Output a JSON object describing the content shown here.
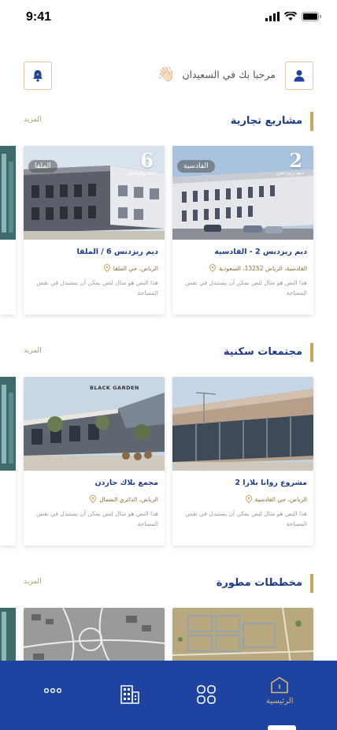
{
  "status": {
    "time": "9:41"
  },
  "header": {
    "greeting": "مرحبا بك في السعيدان",
    "wave_emoji": "👋🏻"
  },
  "sections": [
    {
      "title": "مشاريع تجارية",
      "more": "المزيد",
      "cards": [
        {
          "title": "ديم ريزدنس 2 - القادسية",
          "location": "القادسية، الرياض 13252، السعودية",
          "tag": "القادسية",
          "description": "هذا النص هو مثال لنص يمكن أن يستبدل في نفس المساحة",
          "image_text": "2",
          "image_brand": "ديم ريزدنس"
        },
        {
          "title": "ديم ريزدنس 6 / الملقا",
          "location": "الرياض، حي الملقا",
          "tag": "الملقا",
          "description": "هذا النص هو مثال لنص يمكن أن يستبدل في نفس المساحة",
          "image_text": "6",
          "image_brand": "ديم ريزدنس"
        }
      ]
    },
    {
      "title": "مجتمعات سكنية",
      "more": "المزيد",
      "cards": [
        {
          "title": "مشروع روانا بلازا 2",
          "location": "الرياض، حي القادسية",
          "tag": "",
          "description": "هذا النص هو مثال لنص يمكن أن يستبدل في نفس المساحة",
          "image_text": "",
          "image_brand": ""
        },
        {
          "title": "مجمع بلاك جاردن",
          "location": "الرياض، الدائري الشمال",
          "tag": "",
          "description": "هذا النص هو مثال لنص يمكن أن يستبدل في نفس المساحة",
          "image_text": "",
          "image_brand": "BLACK GARDEN"
        }
      ]
    },
    {
      "title": "مخططات مطورة",
      "more": "المزيد",
      "cards": []
    }
  ],
  "nav": {
    "home_label": "الرئيسية",
    "active_color": "#d9b876",
    "bg_color": "#1e43a0"
  },
  "colors": {
    "brand_blue": "#1b3b8c",
    "gold": "#c9a55e"
  }
}
